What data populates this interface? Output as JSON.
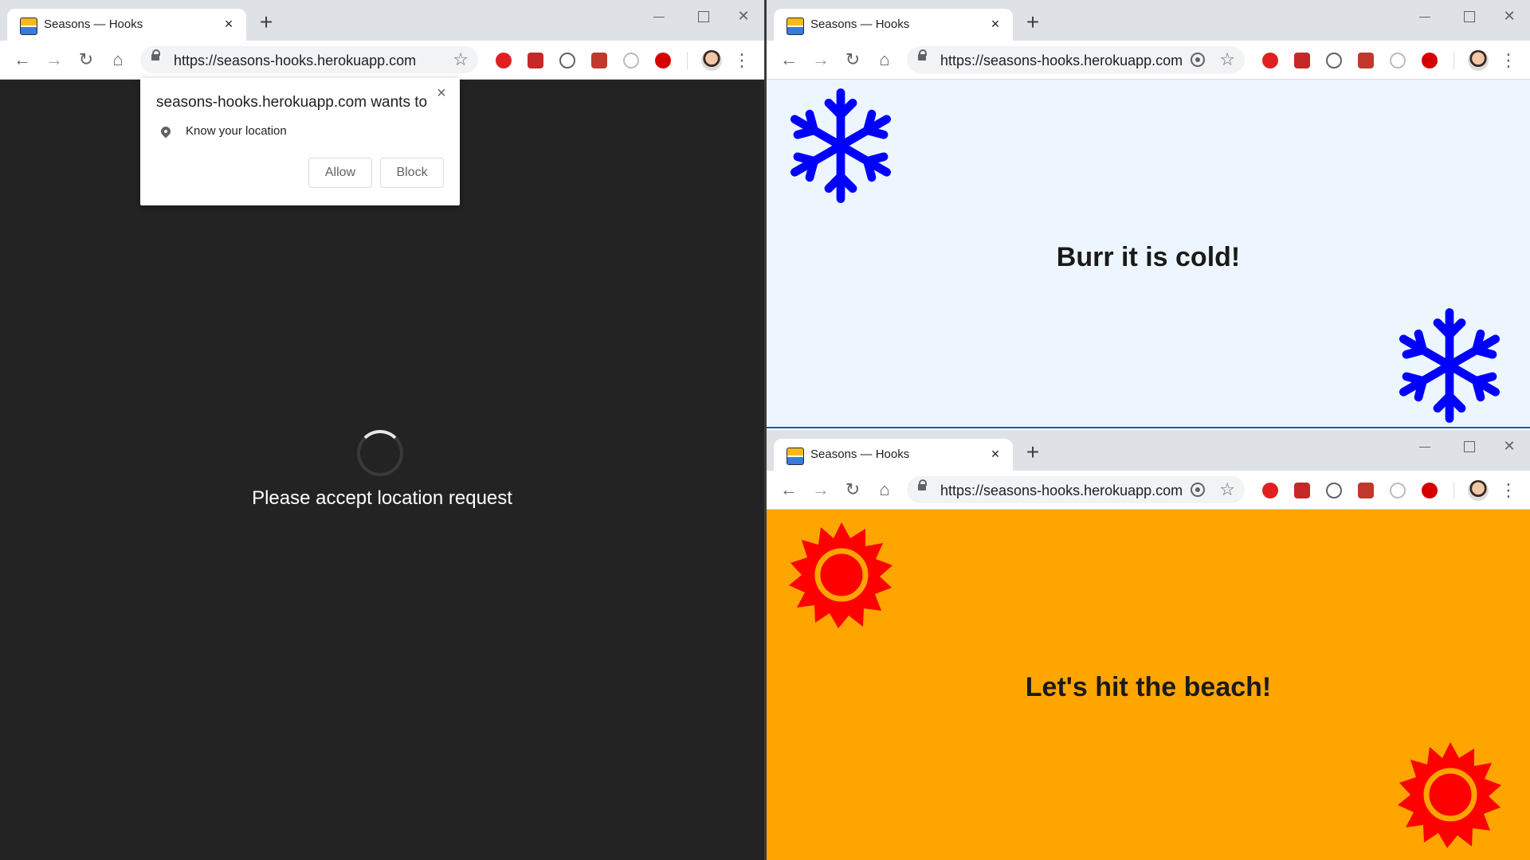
{
  "windows": {
    "left": {
      "tab_title": "Seasons — Hooks",
      "url": "https://seasons-hooks.herokuapp.com",
      "loading_text": "Please accept location request",
      "permission_popup": {
        "title": "seasons-hooks.herokuapp.com wants to",
        "item": "Know your location",
        "allow_label": "Allow",
        "block_label": "Block"
      }
    },
    "right_top": {
      "tab_title": "Seasons — Hooks",
      "url": "https://seasons-hooks.herokuapp.com",
      "message": "Burr it is cold!",
      "background_color": "#edf6ff",
      "icon_color": "#0000ff",
      "icon": "snowflake-icon"
    },
    "right_bottom": {
      "tab_title": "Seasons — Hooks",
      "url": "https://seasons-hooks.herokuapp.com",
      "message": "Let's hit the beach!",
      "background_color": "#ffa500",
      "icon_color": "#ff0000",
      "icon": "sun-icon"
    }
  },
  "icons": {
    "close": "×",
    "new_tab": "+",
    "back": "←",
    "forward": "→",
    "reload": "↻",
    "home": "⌂",
    "star": "☆",
    "menu": "⋮",
    "window_close": "✕"
  },
  "colors": {
    "left_content_bg": "#232323",
    "tab_strip": "#dee1e6"
  }
}
